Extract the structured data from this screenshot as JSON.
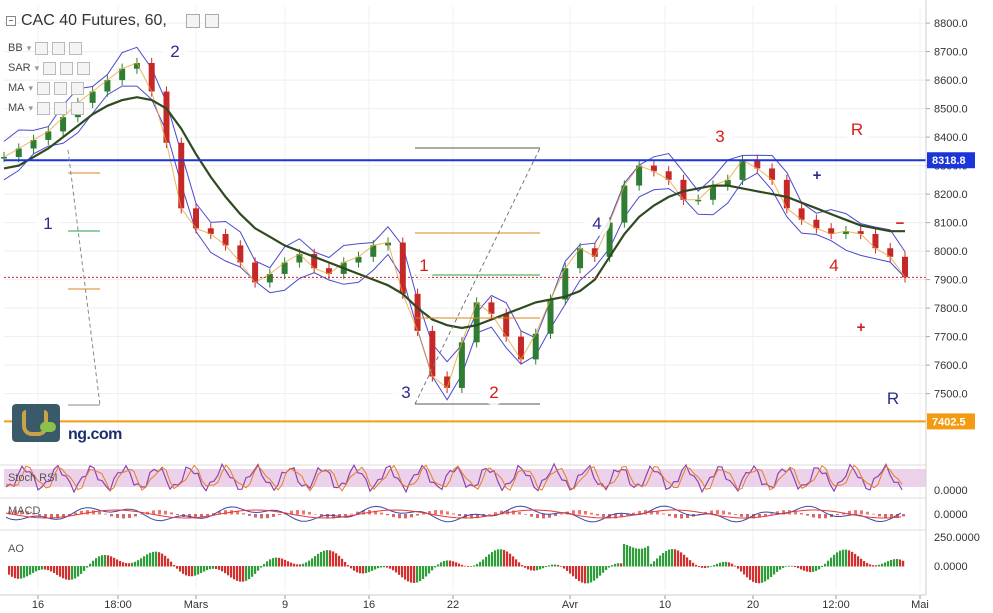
{
  "header": {
    "title": "CAC 40 Futures, 60,",
    "indicators": [
      {
        "label": "BB"
      },
      {
        "label": "SAR"
      },
      {
        "label": "MA"
      },
      {
        "label": "MA"
      }
    ]
  },
  "colors": {
    "ma_long": "#2f4a1f",
    "bb": "#4a4ad0",
    "price_up": "#2e7d32",
    "price_down": "#c62828",
    "resistance_line": "#1a35d8",
    "support_line": "#f39c12",
    "current_price_line": "#c62828",
    "wave_blue": "#2b2b8f",
    "wave_red": "#d81b1b"
  },
  "logo": {
    "text": "ng.com"
  },
  "chart_data": [
    {
      "type": "line",
      "title": "CAC 40 Futures, 60,",
      "ylim": [
        7260,
        8860
      ],
      "yticks": [
        8800,
        8700,
        8600,
        8500,
        8400,
        8300,
        8200,
        8100,
        8000,
        7900,
        7800,
        7700,
        7600,
        7500
      ],
      "ytick_labels": [
        "8800.0",
        "8700.0",
        "8600.0",
        "8500.0",
        "8400.0",
        "8300.0",
        "8200.0",
        "8100.0",
        "8000.0",
        "7900.0",
        "7800.0",
        "7700.0",
        "7600.0",
        "7500.0"
      ],
      "xticks": [
        "16",
        "18:00",
        "Mars",
        "9",
        "16",
        "22",
        "Avr",
        "10",
        "20",
        "12:00",
        "Mai"
      ],
      "price_tags": [
        {
          "label": "8318.8",
          "value": 8318.8,
          "color": "#1a35d8"
        },
        {
          "label": "7402.5",
          "value": 7402.5,
          "color": "#f39c12"
        }
      ],
      "levels": [
        {
          "name": "resistance",
          "value": 8318.8
        },
        {
          "name": "support",
          "value": 7402.5
        },
        {
          "name": "last",
          "value": 7908
        }
      ],
      "series": [
        {
          "values": [
            8330,
            8360,
            8390,
            8420,
            8470,
            8520,
            8560,
            8600,
            8640,
            8660,
            8560,
            8380,
            8150,
            8080,
            8060,
            8020,
            7960,
            7890,
            7920,
            7960,
            7990,
            7940,
            7920,
            7960,
            7980,
            8020,
            8030,
            7850,
            7720,
            7560,
            7520,
            7680,
            7820,
            7780,
            7700,
            7620,
            7710,
            7830,
            7940,
            8010,
            7980,
            8100,
            8230,
            8300,
            8280,
            8250,
            8180,
            8180,
            8230,
            8250,
            8320,
            8290,
            8250,
            8150,
            8110,
            8080,
            8060,
            8070,
            8060,
            8010,
            7980,
            7908
          ]
        },
        {
          "values": [
            8290,
            8300,
            8330,
            8360,
            8400,
            8440,
            8480,
            8510,
            8530,
            8540,
            8530,
            8500,
            8430,
            8340,
            8260,
            8190,
            8130,
            8080,
            8050,
            8020,
            8000,
            7980,
            7960,
            7940,
            7920,
            7900,
            7880,
            7850,
            7800,
            7760,
            7740,
            7730,
            7740,
            7760,
            7780,
            7800,
            7820,
            7830,
            7840,
            7860,
            7900,
            7980,
            8060,
            8120,
            8160,
            8190,
            8210,
            8220,
            8230,
            8230,
            8220,
            8210,
            8200,
            8190,
            8170,
            8150,
            8130,
            8110,
            8090,
            8080,
            8070,
            8070
          ]
        }
      ],
      "wave_labels": [
        {
          "text": "1",
          "color": "#2b2b8f",
          "value": 8100
        },
        {
          "text": "2",
          "color": "#2b2b8f",
          "value": 8665
        },
        {
          "text": "3",
          "color": "#2b2b8f",
          "value": 7537
        },
        {
          "text": "2",
          "color": "#d81b1b",
          "value": 7537
        },
        {
          "text": "1",
          "color": "#d81b1b",
          "value": 7962
        },
        {
          "text": "4",
          "color": "#2b2b8f",
          "value": 8102
        },
        {
          "text": "3",
          "color": "#d81b1b",
          "value": 8387
        },
        {
          "text": "R",
          "color": "#d81b1b",
          "value": 8407
        },
        {
          "text": "4",
          "color": "#d81b1b",
          "value": 7962
        },
        {
          "text": "R",
          "color": "#2b2b8f",
          "value": 7517
        }
      ],
      "markers": [
        {
          "text": "+",
          "color": "#2b2b8f",
          "value": 8265
        },
        {
          "text": "−",
          "color": "#d81b1b",
          "value": 8102
        },
        {
          "text": "+",
          "color": "#d81b1b",
          "value": 7760
        }
      ]
    },
    {
      "type": "line",
      "title": "Stoch RSI",
      "yticks": [
        0
      ],
      "ytick_labels": [
        "0.0000"
      ]
    },
    {
      "type": "line",
      "title": "MACD",
      "yticks": [
        0
      ],
      "ytick_labels": [
        "0.0000"
      ]
    },
    {
      "type": "bar",
      "title": "AO",
      "yticks": [
        250,
        0
      ],
      "ytick_labels": [
        "250.0000",
        "0.0000"
      ]
    }
  ]
}
